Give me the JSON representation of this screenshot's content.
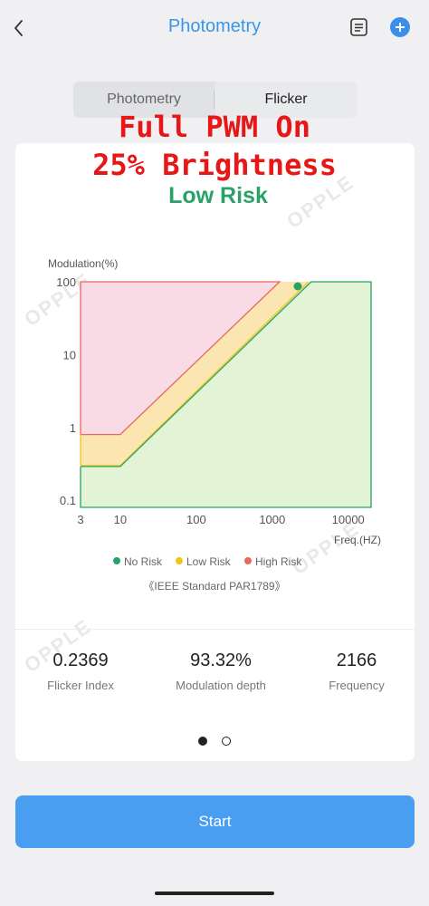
{
  "header": {
    "title": "Photometry",
    "back_icon": "chevron-left-icon",
    "list_icon": "document-list-icon",
    "add_icon": "plus-circle-icon"
  },
  "tabs": [
    {
      "label": "Photometry",
      "selected": false
    },
    {
      "label": "Flicker",
      "selected": true
    }
  ],
  "overlay": {
    "line1": "Full PWM On",
    "line2": "25% Brightness",
    "line3": "Low Risk"
  },
  "watermark": "OPPLE",
  "legend": [
    {
      "label": "No Risk",
      "color": "#2aa166"
    },
    {
      "label": "Low Risk",
      "color": "#f2c617"
    },
    {
      "label": "High Risk",
      "color": "#e8675e"
    }
  ],
  "standard": "《IEEE Standard PAR1789》",
  "chart_data": {
    "type": "area",
    "x_scale": "log",
    "y_scale": "log",
    "ylabel": "Modulation(%)",
    "xlabel": "Freq.(HZ)",
    "x_ticks": [
      "3",
      "10",
      "100",
      "1000",
      "10000"
    ],
    "y_ticks": [
      "0.1",
      "1",
      "10",
      "100"
    ],
    "xlim": [
      3,
      20000
    ],
    "ylim": [
      0.08,
      100
    ],
    "regions": [
      {
        "name": "No Risk",
        "color": "#2aa166",
        "fill": "#e2f3d6"
      },
      {
        "name": "Low Risk",
        "color": "#f2c617",
        "fill": "#fbe6b1"
      },
      {
        "name": "High Risk",
        "color": "#e8675e",
        "fill": "#f8dbe5"
      }
    ],
    "low_risk_boundary": [
      [
        3,
        0.3
      ],
      [
        10,
        0.3
      ],
      [
        3000,
        100
      ]
    ],
    "high_risk_boundary": [
      [
        3,
        0.8
      ],
      [
        10,
        0.8
      ],
      [
        1250,
        100
      ]
    ],
    "measurement": {
      "frequency": 2166,
      "modulation": 93.32
    }
  },
  "stats": [
    {
      "value": "0.2369",
      "label": "Flicker Index"
    },
    {
      "value": "93.32%",
      "label": "Modulation depth"
    },
    {
      "value": "2166",
      "label": "Frequency"
    }
  ],
  "pager": {
    "pages": 2,
    "current": 1
  },
  "start_button": {
    "label": "Start"
  }
}
